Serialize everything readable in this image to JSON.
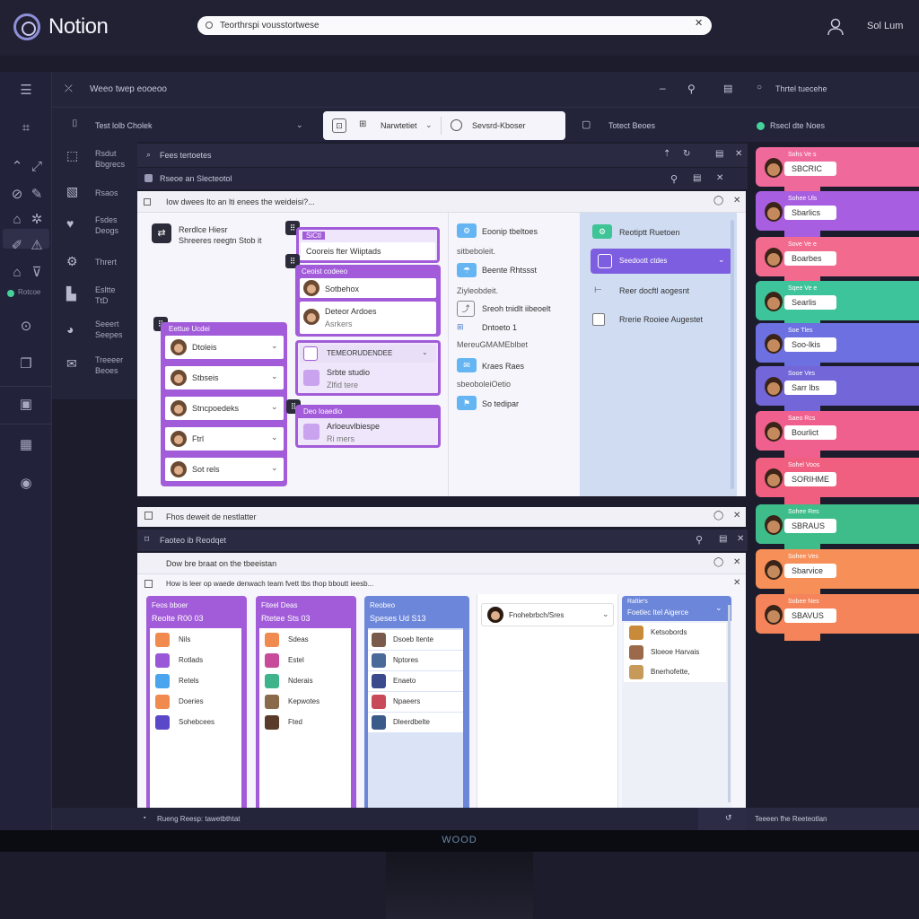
{
  "app": {
    "name": "Notion",
    "user": "Sol Lum"
  },
  "search": {
    "value": "Teorthrspi vousstortwese"
  },
  "toolbar": {
    "path": "Weeo twep eooeoo",
    "right_label": "Thrtel tuecehe"
  },
  "viewbar": {
    "left_label": "Test lolb Cholek",
    "button1": "Narwtetiet",
    "button2": "Sevsrd-Kboser",
    "right_label": "Totect Beoes",
    "status": "Rsecl dte Noes"
  },
  "sidebar2": {
    "items": [
      {
        "label1": "Rsdut",
        "label2": "Bbgrecs"
      },
      {
        "label1": "Rsaos",
        "label2": ""
      },
      {
        "label1": "Fsdes",
        "label2": "Deogs"
      },
      {
        "label1": "Thrert",
        "label2": ""
      },
      {
        "label1": "Esltte",
        "label2": "TtD"
      },
      {
        "label1": "Seeert",
        "label2": "Seepes"
      },
      {
        "label1": "Treeeer",
        "label2": "Beoes"
      }
    ],
    "rail_badge": "Rotcoe"
  },
  "top_section": {
    "title": "Fees tertoetes",
    "subtitle": "Rseoe an Slecteotol",
    "question": "Iow dwees Ito an lti enees the weideisi?...",
    "left_block": {
      "title": "Rerdlce Hiesr",
      "sub": "Shreeres reegtn Stob it"
    },
    "group1": {
      "tag": "SiCtl",
      "title": "Cooreis fter Wiiptads"
    },
    "group2": {
      "tag": "Ceoist codeeo",
      "rows": [
        {
          "name": "Sotbehox"
        },
        {
          "name": "Deteor Ardoes",
          "sub": "Asrkers"
        }
      ]
    },
    "group3": {
      "tag": "Eettue Ucdei",
      "rows": [
        "Dtoleis",
        "Stbseis",
        "Stncpoedeks",
        "Ftrl",
        "Sot rels"
      ]
    },
    "group4": {
      "row1": "TEMEORUDENDEE",
      "row2": "Srbte studio",
      "row3": "Zlfid tere"
    },
    "group5": {
      "tag": "Deo Ioaedio",
      "row1": "Arloeuvlbiespe",
      "row2": "Ri mers"
    },
    "col3": [
      {
        "label": "Eoonip tbeltoes",
        "sub": "sitbeboleit."
      },
      {
        "label": "Beente Rhtssst",
        "sub": "Ziyleobdeit."
      },
      {
        "label": "Sreoh tnidlt iibeoelt",
        "sub": ""
      },
      {
        "label": "Dntoeto 1",
        "sub": "MereuGMAMEblbet"
      },
      {
        "label": "Kraes Raes",
        "sub": "sbeoboleiOetio"
      },
      {
        "label": "So tedipar",
        "sub": ""
      }
    ],
    "col4": [
      {
        "label": "Reotiptt Ruetoen"
      },
      {
        "label": "Seedoott ctdes"
      },
      {
        "label": "Reer docftl aogesnt"
      },
      {
        "label": "Rrerie Rooiee Augestet"
      }
    ]
  },
  "mid_bar": {
    "label": "Fhos deweit de nestlatter"
  },
  "bottom_section": {
    "title": "Faoteo ib Reodqet",
    "question": "Dow bre braat on the tbeeistan",
    "question2": "How is leer op waede denwach team fvett tbs thop bboutt ieesb...",
    "columns": [
      {
        "head1": "Feos bboer",
        "head2": "Reolte R00 03",
        "rows": [
          "Nils",
          "Rotlads",
          "Retels",
          "Doeries",
          "Sohebcees"
        ]
      },
      {
        "head1": "Fiteel Deas",
        "head2": "Rtetee Sts 03",
        "rows": [
          "Sdeas",
          "Estel",
          "Nderais",
          "Kepwotes",
          "Fted"
        ]
      },
      {
        "head1": "Reobeo",
        "head2": "Speses Ud S13",
        "rows": [
          "Dsoeb ltente",
          "Nptores",
          "Enaeto",
          "Npaeers",
          "Dleerdbelte"
        ]
      }
    ],
    "picker": {
      "label": "Fnohebrbch/Sres"
    },
    "dropdown": {
      "head1": "Raltie's",
      "head2": "Foetlec Itel Aigerce",
      "items": [
        "Ketsobords",
        "Sloeoe Harvais",
        "Bnerhofette,"
      ]
    }
  },
  "right_list": [
    {
      "small": "Sohs Ve s",
      "name": "SBCRIC",
      "color": "#f0699b"
    },
    {
      "small": "Sohee Uls",
      "name": "Sbarlics",
      "color": "#a85ee0"
    },
    {
      "small": "Sove Ve e",
      "name": "Boarbes",
      "color": "#f26a8e"
    },
    {
      "small": "Sqee Ve e",
      "name": "Searlis",
      "color": "#3ec49a"
    },
    {
      "small": "Soe Tles",
      "name": "Soo-lkis",
      "color": "#6c70e0"
    },
    {
      "small": "Sooe Ves",
      "name": "Sarr lbs",
      "color": "#7266d8"
    },
    {
      "small": "Saeo Rcs",
      "name": "Bourlict",
      "color": "#f0608e"
    },
    {
      "small": "Sohel Voos",
      "name": "SORIHME",
      "color": "#f05e80"
    },
    {
      "small": "Sohee Res",
      "name": "SBRAUS",
      "color": "#3ebc8a"
    },
    {
      "small": "Sohee Ves",
      "name": "Sbarvice",
      "color": "#f68f58"
    },
    {
      "small": "Sobee Nes",
      "name": "SBAVUS",
      "color": "#f5845a"
    }
  ],
  "footer": {
    "left": "Rueng Reesp: tawetbthtat",
    "right": "Teeeen fhe Reeteotlan"
  },
  "monitor": {
    "brand": "WOOD"
  }
}
